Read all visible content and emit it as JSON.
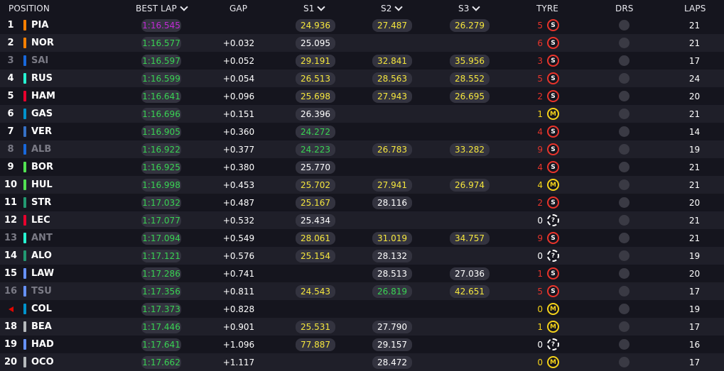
{
  "headers": {
    "position": "POSITION",
    "best_lap": "BEST LAP",
    "gap": "GAP",
    "s1": "S1",
    "s2": "S2",
    "s3": "S3",
    "tyre": "TYRE",
    "drs": "DRS",
    "laps": "LAPS"
  },
  "colors": {
    "purple": "#c12ad6",
    "green": "#39d353",
    "yellow": "#f5e63d",
    "soft": "#e8342b",
    "medium": "#f5d31a"
  },
  "rows": [
    {
      "pos": "1",
      "driver": "PIA",
      "team_color": "#ff8000",
      "best_lap": "1:16.545",
      "best_lap_color": "purple",
      "gap": "",
      "s1": "24.936",
      "s1_color": "yellow",
      "s2": "27.487",
      "s2_color": "yellow",
      "s3": "26.279",
      "s3_color": "yellow",
      "stops": "5",
      "tyre": "S",
      "tyre_type": "soft",
      "laps": "21",
      "retired": false
    },
    {
      "pos": "2",
      "driver": "NOR",
      "team_color": "#ff8000",
      "best_lap": "1:16.577",
      "best_lap_color": "green",
      "gap": "+0.032",
      "s1": "25.095",
      "s1_color": "white",
      "s2": "",
      "s2_color": "",
      "s3": "",
      "s3_color": "",
      "stops": "6",
      "tyre": "S",
      "tyre_type": "soft",
      "laps": "21",
      "retired": false
    },
    {
      "pos": "3",
      "driver": "SAI",
      "team_color": "#1868db",
      "best_lap": "1:16.597",
      "best_lap_color": "green",
      "gap": "+0.052",
      "s1": "29.191",
      "s1_color": "yellow",
      "s2": "32.841",
      "s2_color": "yellow",
      "s3": "35.956",
      "s3_color": "yellow",
      "stops": "3",
      "tyre": "S",
      "tyre_type": "soft",
      "laps": "17",
      "retired": true
    },
    {
      "pos": "4",
      "driver": "RUS",
      "team_color": "#27f4d2",
      "best_lap": "1:16.599",
      "best_lap_color": "green",
      "gap": "+0.054",
      "s1": "26.513",
      "s1_color": "yellow",
      "s2": "28.563",
      "s2_color": "yellow",
      "s3": "28.552",
      "s3_color": "yellow",
      "stops": "5",
      "tyre": "S",
      "tyre_type": "soft",
      "laps": "24",
      "retired": false
    },
    {
      "pos": "5",
      "driver": "HAM",
      "team_color": "#e8002d",
      "best_lap": "1:16.641",
      "best_lap_color": "green",
      "gap": "+0.096",
      "s1": "25.698",
      "s1_color": "yellow",
      "s2": "27.943",
      "s2_color": "yellow",
      "s3": "26.695",
      "s3_color": "yellow",
      "stops": "2",
      "tyre": "S",
      "tyre_type": "soft",
      "laps": "20",
      "retired": false
    },
    {
      "pos": "6",
      "driver": "GAS",
      "team_color": "#0093cc",
      "best_lap": "1:16.696",
      "best_lap_color": "green",
      "gap": "+0.151",
      "s1": "26.396",
      "s1_color": "white",
      "s2": "",
      "s2_color": "",
      "s3": "",
      "s3_color": "",
      "stops": "1",
      "tyre": "M",
      "tyre_type": "med",
      "laps": "21",
      "retired": false
    },
    {
      "pos": "7",
      "driver": "VER",
      "team_color": "#3671c6",
      "best_lap": "1:16.905",
      "best_lap_color": "green",
      "gap": "+0.360",
      "s1": "24.272",
      "s1_color": "green",
      "s2": "",
      "s2_color": "",
      "s3": "",
      "s3_color": "",
      "stops": "4",
      "tyre": "S",
      "tyre_type": "soft",
      "laps": "14",
      "retired": false
    },
    {
      "pos": "8",
      "driver": "ALB",
      "team_color": "#1868db",
      "best_lap": "1:16.922",
      "best_lap_color": "green",
      "gap": "+0.377",
      "s1": "24.223",
      "s1_color": "green",
      "s2": "26.783",
      "s2_color": "yellow",
      "s3": "33.282",
      "s3_color": "yellow",
      "stops": "9",
      "tyre": "S",
      "tyre_type": "soft",
      "laps": "19",
      "retired": true
    },
    {
      "pos": "9",
      "driver": "BOR",
      "team_color": "#52e252",
      "best_lap": "1:16.925",
      "best_lap_color": "green",
      "gap": "+0.380",
      "s1": "25.770",
      "s1_color": "white",
      "s2": "",
      "s2_color": "",
      "s3": "",
      "s3_color": "",
      "stops": "4",
      "tyre": "S",
      "tyre_type": "soft",
      "laps": "21",
      "retired": false
    },
    {
      "pos": "10",
      "driver": "HUL",
      "team_color": "#52e252",
      "best_lap": "1:16.998",
      "best_lap_color": "green",
      "gap": "+0.453",
      "s1": "25.702",
      "s1_color": "yellow",
      "s2": "27.941",
      "s2_color": "yellow",
      "s3": "26.974",
      "s3_color": "yellow",
      "stops": "4",
      "tyre": "M",
      "tyre_type": "med",
      "laps": "21",
      "retired": false
    },
    {
      "pos": "11",
      "driver": "STR",
      "team_color": "#229971",
      "best_lap": "1:17.032",
      "best_lap_color": "green",
      "gap": "+0.487",
      "s1": "25.167",
      "s1_color": "yellow",
      "s2": "28.116",
      "s2_color": "white",
      "s3": "",
      "s3_color": "",
      "stops": "2",
      "tyre": "S",
      "tyre_type": "soft",
      "laps": "20",
      "retired": false
    },
    {
      "pos": "12",
      "driver": "LEC",
      "team_color": "#e8002d",
      "best_lap": "1:17.077",
      "best_lap_color": "green",
      "gap": "+0.532",
      "s1": "25.434",
      "s1_color": "white",
      "s2": "",
      "s2_color": "",
      "s3": "",
      "s3_color": "",
      "stops": "0",
      "tyre": "?",
      "tyre_type": "unk",
      "laps": "21",
      "retired": false
    },
    {
      "pos": "13",
      "driver": "ANT",
      "team_color": "#27f4d2",
      "best_lap": "1:17.094",
      "best_lap_color": "green",
      "gap": "+0.549",
      "s1": "28.061",
      "s1_color": "yellow",
      "s2": "31.019",
      "s2_color": "yellow",
      "s3": "34.757",
      "s3_color": "yellow",
      "stops": "9",
      "tyre": "S",
      "tyre_type": "soft",
      "laps": "21",
      "retired": true
    },
    {
      "pos": "14",
      "driver": "ALO",
      "team_color": "#229971",
      "best_lap": "1:17.121",
      "best_lap_color": "green",
      "gap": "+0.576",
      "s1": "25.154",
      "s1_color": "yellow",
      "s2": "28.132",
      "s2_color": "white",
      "s3": "",
      "s3_color": "",
      "stops": "0",
      "tyre": "?",
      "tyre_type": "unk",
      "laps": "19",
      "retired": false
    },
    {
      "pos": "15",
      "driver": "LAW",
      "team_color": "#6692ff",
      "best_lap": "1:17.286",
      "best_lap_color": "green",
      "gap": "+0.741",
      "s1": "",
      "s1_color": "",
      "s2": "28.513",
      "s2_color": "white",
      "s3": "27.036",
      "s3_color": "white",
      "stops": "1",
      "tyre": "S",
      "tyre_type": "soft",
      "laps": "20",
      "retired": false
    },
    {
      "pos": "16",
      "driver": "TSU",
      "team_color": "#6692ff",
      "best_lap": "1:17.356",
      "best_lap_color": "green",
      "gap": "+0.811",
      "s1": "24.543",
      "s1_color": "yellow",
      "s2": "26.819",
      "s2_color": "green",
      "s3": "42.651",
      "s3_color": "yellow",
      "stops": "5",
      "tyre": "S",
      "tyre_type": "soft",
      "laps": "17",
      "retired": true
    },
    {
      "pos": "",
      "driver": "COL",
      "team_color": "#0093cc",
      "best_lap": "1:17.373",
      "best_lap_color": "green",
      "gap": "+0.828",
      "s1": "",
      "s1_color": "",
      "s2": "",
      "s2_color": "",
      "s3": "",
      "s3_color": "",
      "stops": "0",
      "tyre": "M",
      "tyre_type": "med",
      "laps": "19",
      "retired": false,
      "arrow": true
    },
    {
      "pos": "18",
      "driver": "BEA",
      "team_color": "#b6babd",
      "best_lap": "1:17.446",
      "best_lap_color": "green",
      "gap": "+0.901",
      "s1": "25.531",
      "s1_color": "yellow",
      "s2": "27.790",
      "s2_color": "white",
      "s3": "",
      "s3_color": "",
      "stops": "1",
      "tyre": "M",
      "tyre_type": "med",
      "laps": "17",
      "retired": false
    },
    {
      "pos": "19",
      "driver": "HAD",
      "team_color": "#6692ff",
      "best_lap": "1:17.641",
      "best_lap_color": "green",
      "gap": "+1.096",
      "s1": "77.887",
      "s1_color": "yellow",
      "s2": "29.157",
      "s2_color": "white",
      "s3": "",
      "s3_color": "",
      "stops": "0",
      "tyre": "?",
      "tyre_type": "unk",
      "laps": "16",
      "retired": false
    },
    {
      "pos": "20",
      "driver": "OCO",
      "team_color": "#b6babd",
      "best_lap": "1:17.662",
      "best_lap_color": "green",
      "gap": "+1.117",
      "s1": "",
      "s1_color": "",
      "s2": "28.472",
      "s2_color": "white",
      "s3": "",
      "s3_color": "",
      "stops": "0",
      "tyre": "M",
      "tyre_type": "med",
      "laps": "17",
      "retired": false
    }
  ]
}
